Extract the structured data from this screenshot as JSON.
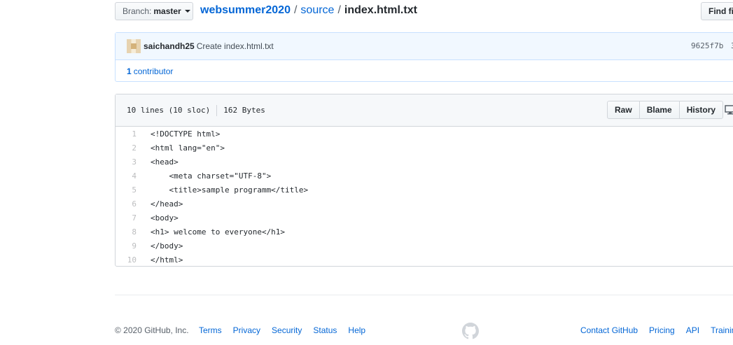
{
  "header": {
    "branch_label": "Branch:",
    "branch_value": "master",
    "repo": "websummer2020",
    "path_segment": "source",
    "separator": "/",
    "file_name": "index.html.txt",
    "find_button": "Find fi"
  },
  "commit": {
    "author": "saichandh25",
    "message": "Create index.html.txt",
    "sha": "9625f7b",
    "truncated_after_sha": "3",
    "contributors_count": "1",
    "contributors_label": "contributor"
  },
  "file": {
    "lines_info": "10 lines (10 sloc)",
    "size": "162 Bytes",
    "buttons": [
      "Raw",
      "Blame",
      "History"
    ]
  },
  "code_lines": [
    {
      "num": "1",
      "text": "<!DOCTYPE html>"
    },
    {
      "num": "2",
      "text": "<html lang=\"en\">"
    },
    {
      "num": "3",
      "text": "<head>"
    },
    {
      "num": "4",
      "text": "    <meta charset=\"UTF-8\">"
    },
    {
      "num": "5",
      "text": "    <title>sample programm</title>"
    },
    {
      "num": "6",
      "text": "</head>"
    },
    {
      "num": "7",
      "text": "<body>"
    },
    {
      "num": "8",
      "text": "<h1> welcome to everyone</h1>"
    },
    {
      "num": "9",
      "text": "</body>"
    },
    {
      "num": "10",
      "text": "</html>"
    }
  ],
  "footer": {
    "copyright": "© 2020 GitHub, Inc.",
    "left_links": [
      "Terms",
      "Privacy",
      "Security",
      "Status",
      "Help"
    ],
    "right_links": [
      "Contact GitHub",
      "Pricing",
      "API",
      "Trainin"
    ]
  },
  "colors": {
    "link": "#0366d6",
    "commit_bg": "#f1f8ff",
    "file_header_bg": "#f6f8fa"
  }
}
